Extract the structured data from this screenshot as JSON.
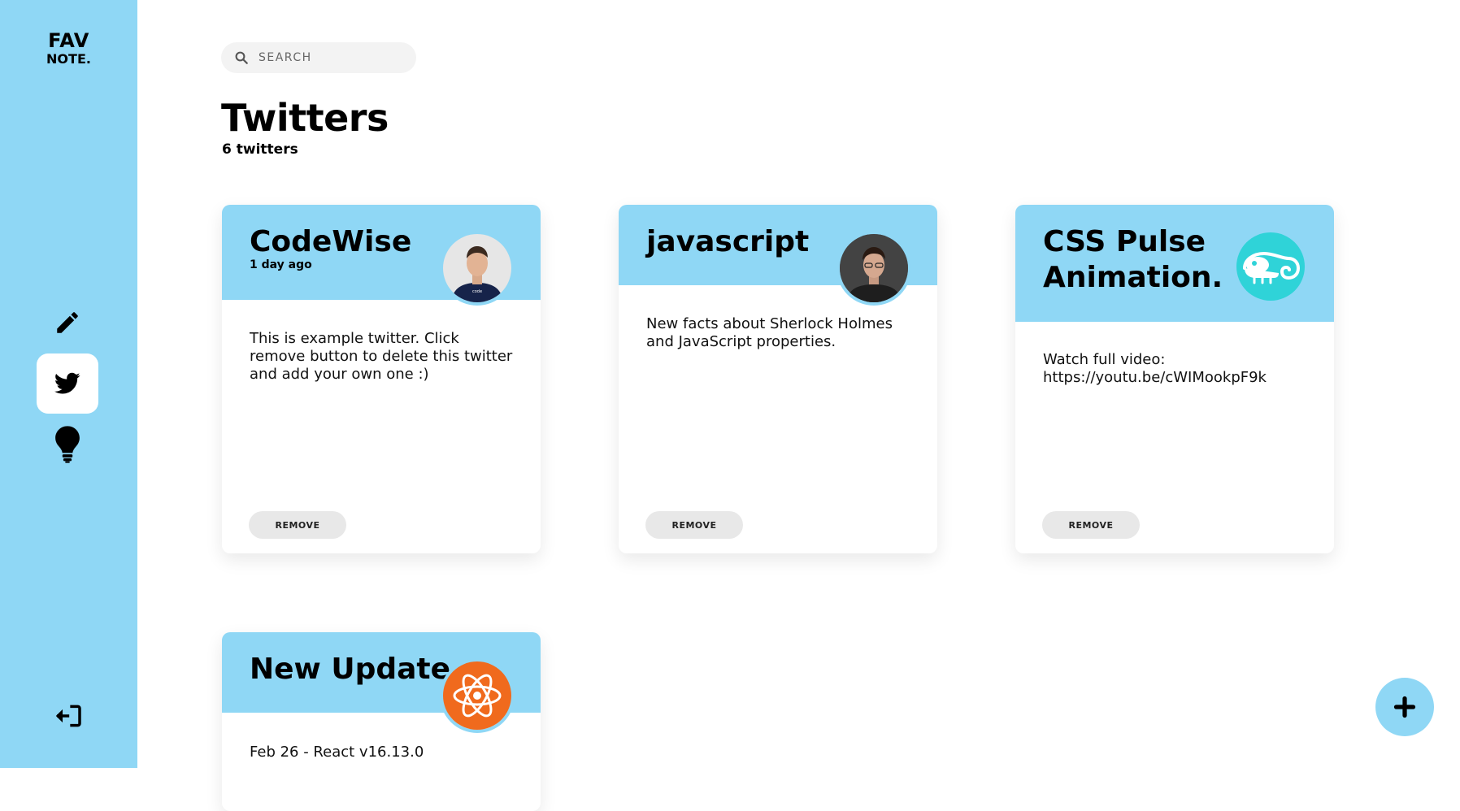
{
  "app": {
    "logo_line1": "FAV",
    "logo_line2": "NOTE."
  },
  "sidebar": {
    "items": [
      {
        "name": "notes",
        "icon": "pen-icon",
        "active": false
      },
      {
        "name": "twitters",
        "icon": "twitter-icon",
        "active": true
      },
      {
        "name": "articles",
        "icon": "lightbulb-icon",
        "active": false
      }
    ],
    "logout_icon": "logout-icon"
  },
  "search": {
    "placeholder": "SEARCH",
    "value": ""
  },
  "page": {
    "title": "Twitters",
    "count_label": "6 twitters"
  },
  "cards": [
    {
      "title": "CodeWise",
      "date": "1 day ago",
      "body": "This is example twitter. Click remove button to delete this twitter and add your own one :)",
      "remove_label": "REMOVE",
      "avatar": "person-avatar"
    },
    {
      "title": "javascript",
      "date": "",
      "body": "New facts about Sherlock Holmes and JavaScript properties.",
      "remove_label": "REMOVE",
      "avatar": "person-avatar"
    },
    {
      "title": "CSS Pulse Animation.",
      "date": "",
      "body_line1": "Watch full video:",
      "body_line2": "https://youtu.be/cWIMookpF9k",
      "remove_label": "REMOVE",
      "avatar": "chameleon-logo"
    },
    {
      "title": "New Update",
      "date": "",
      "body": "Feb 26 - React v16.13.0",
      "avatar": "react-logo"
    }
  ],
  "fab": {
    "icon": "plus-icon"
  },
  "colors": {
    "accent": "#8fd7f5",
    "react_orange": "#f06a1d",
    "chameleon_teal": "#2fd3d8"
  }
}
